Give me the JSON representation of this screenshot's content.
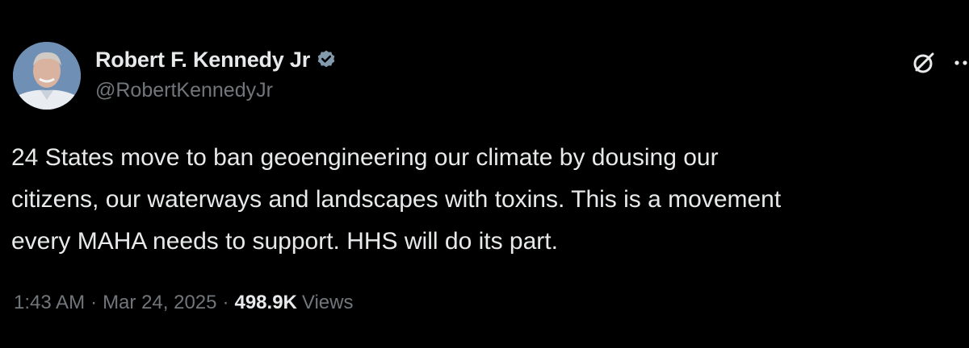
{
  "author": {
    "display_name": "Robert F. Kennedy Jr",
    "handle": "@RobertKennedyJr",
    "verified": true
  },
  "tweet": {
    "lines": [
      "24 States move to ban geoengineering our climate by dousing our",
      "citizens, our waterways and landscapes with toxins. This is a movement",
      "every MAHA needs to support. HHS will do its part."
    ]
  },
  "meta": {
    "time": "1:43 AM",
    "separator": "·",
    "date": "Mar 24, 2025",
    "view_count": "498.9K",
    "views_label": "Views"
  },
  "icons": {
    "grok": "grok-icon",
    "more": "more-icon",
    "verified": "verified-badge-icon"
  },
  "colors": {
    "background": "#000000",
    "primary_text": "#e7e9ea",
    "secondary_text": "#71767b",
    "verified_badge": "#829aab"
  }
}
